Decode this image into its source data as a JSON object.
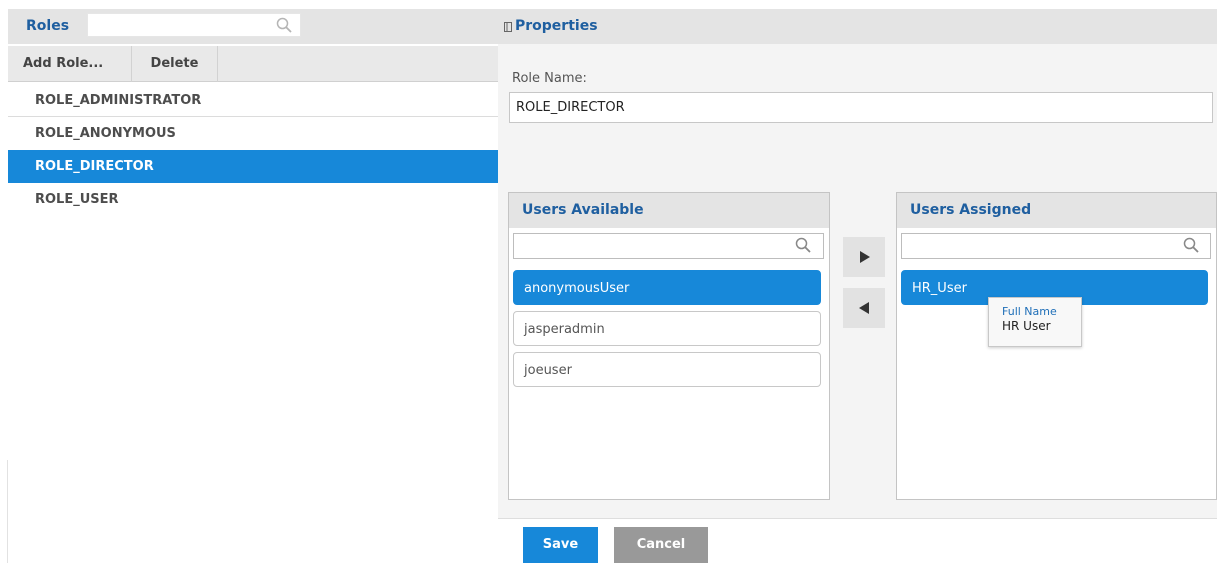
{
  "roles_panel": {
    "title": "Roles",
    "search": {
      "value": "",
      "placeholder": ""
    },
    "toolbar": {
      "add_label": "Add Role...",
      "delete_label": "Delete"
    },
    "roles": [
      {
        "label": "ROLE_ADMINISTRATOR",
        "selected": false
      },
      {
        "label": "ROLE_ANONYMOUS",
        "selected": false
      },
      {
        "label": "ROLE_DIRECTOR",
        "selected": true
      },
      {
        "label": "ROLE_USER",
        "selected": false
      }
    ]
  },
  "properties": {
    "title": "Properties",
    "role_name_label": "Role Name:",
    "role_name_value": "ROLE_DIRECTOR",
    "users_available": {
      "title": "Users Available",
      "search_value": "",
      "items": [
        {
          "label": "anonymousUser",
          "selected": true
        },
        {
          "label": "jasperadmin",
          "selected": false
        },
        {
          "label": "joeuser",
          "selected": false
        }
      ]
    },
    "users_assigned": {
      "title": "Users Assigned",
      "search_value": "",
      "items": [
        {
          "label": "HR_User",
          "selected": true
        }
      ]
    },
    "tooltip": {
      "label": "Full Name",
      "value": "HR User"
    },
    "buttons": {
      "save_label": "Save",
      "cancel_label": "Cancel"
    }
  },
  "colors": {
    "accent": "#1788d9",
    "header_text": "#1f5fa0",
    "header_bg": "#e4e4e4",
    "cancel_bg": "#999999"
  },
  "icons": [
    "search-icon",
    "panel-toggle-icon",
    "move-right-arrow-icon",
    "move-left-arrow-icon"
  ]
}
